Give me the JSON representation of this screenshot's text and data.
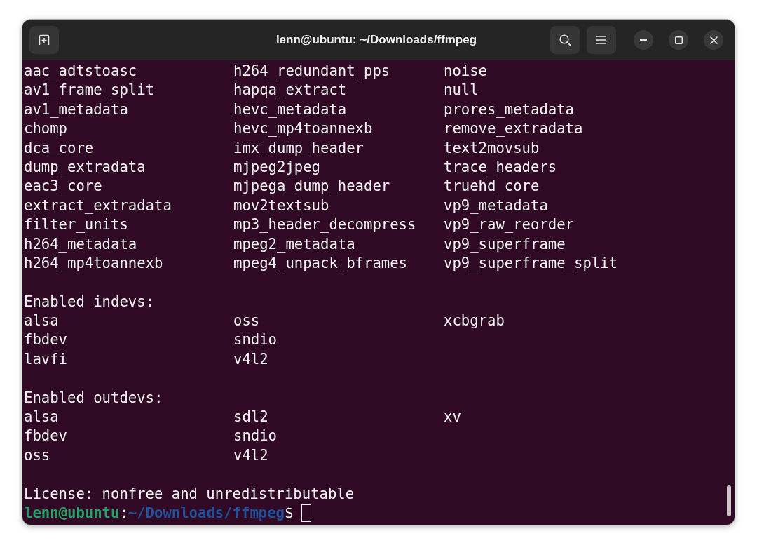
{
  "window": {
    "title": "lenn@ubuntu: ~/Downloads/ffmpeg"
  },
  "terminal": {
    "output": [
      {
        "kind": "columns",
        "rows": [
          [
            "aac_adtstoasc",
            "h264_redundant_pps",
            "noise"
          ],
          [
            "av1_frame_split",
            "hapqa_extract",
            "null"
          ],
          [
            "av1_metadata",
            "hevc_metadata",
            "prores_metadata"
          ],
          [
            "chomp",
            "hevc_mp4toannexb",
            "remove_extradata"
          ],
          [
            "dca_core",
            "imx_dump_header",
            "text2movsub"
          ],
          [
            "dump_extradata",
            "mjpeg2jpeg",
            "trace_headers"
          ],
          [
            "eac3_core",
            "mjpega_dump_header",
            "truehd_core"
          ],
          [
            "extract_extradata",
            "mov2textsub",
            "vp9_metadata"
          ],
          [
            "filter_units",
            "mp3_header_decompress",
            "vp9_raw_reorder"
          ],
          [
            "h264_metadata",
            "mpeg2_metadata",
            "vp9_superframe"
          ],
          [
            "h264_mp4toannexb",
            "mpeg4_unpack_bframes",
            "vp9_superframe_split"
          ]
        ]
      },
      {
        "kind": "columns",
        "heading": "Enabled indevs:",
        "rows": [
          [
            "alsa",
            "oss",
            "xcbgrab"
          ],
          [
            "fbdev",
            "sndio"
          ],
          [
            "lavfi",
            "v4l2"
          ]
        ]
      },
      {
        "kind": "columns",
        "heading": "Enabled outdevs:",
        "rows": [
          [
            "alsa",
            "sdl2",
            "xv"
          ],
          [
            "fbdev",
            "sndio"
          ],
          [
            "oss",
            "v4l2"
          ]
        ]
      },
      {
        "kind": "text",
        "text": "License: nonfree and unredistributable"
      }
    ],
    "prompt": {
      "user_host": "lenn@ubuntu",
      "separator": ":",
      "path": "~/Downloads/ffmpeg",
      "symbol": "$"
    }
  }
}
